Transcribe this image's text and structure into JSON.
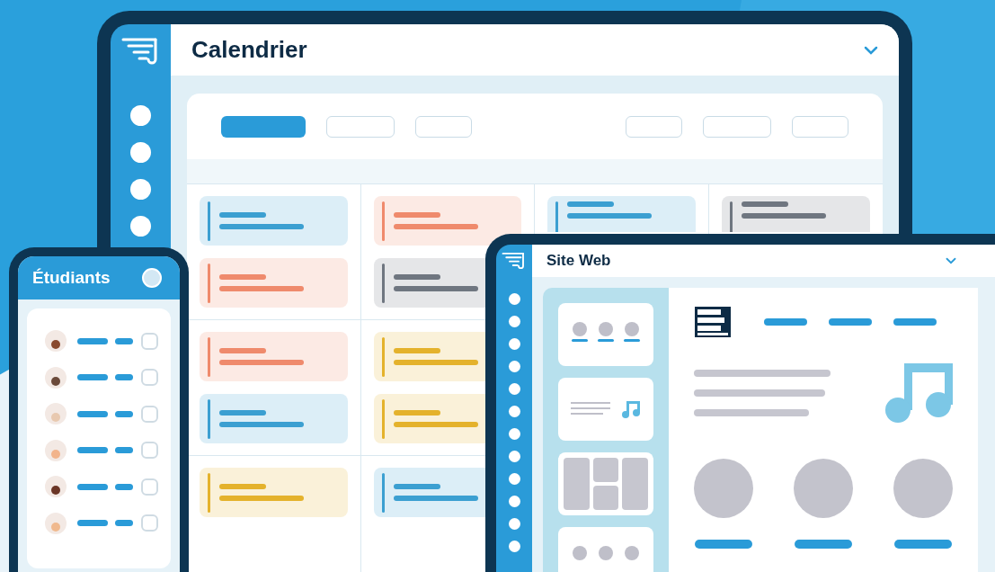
{
  "calendar": {
    "title": "Calendrier",
    "toolbar_buttons": [
      {
        "selected": true
      },
      {
        "selected": false
      },
      {
        "selected": false
      },
      {
        "selected": false
      },
      {
        "selected": false
      },
      {
        "selected": false
      }
    ],
    "weeks": [
      {
        "days": [
          {
            "events": [
              {
                "color": "#3b9fd1"
              },
              {
                "color": "#ef8a6c"
              }
            ]
          },
          {
            "events": [
              {
                "color": "#ef8a6c"
              },
              {
                "color": "#6f7680"
              }
            ]
          },
          {
            "events": [
              {
                "color": "#3b9fd1"
              }
            ]
          },
          {
            "events": [
              {
                "color": "#6f7680"
              }
            ]
          }
        ]
      },
      {
        "days": [
          {
            "events": [
              {
                "color": "#ef8a6c"
              },
              {
                "color": "#3b9fd1"
              }
            ]
          },
          {
            "events": [
              {
                "color": "#e4b22c"
              },
              {
                "color": "#e4b22c"
              }
            ]
          }
        ]
      },
      {
        "days": [
          {
            "events": [
              {
                "color": "#e4b22c"
              }
            ]
          },
          {
            "events": [
              {
                "color": "#3b9fd1"
              }
            ]
          }
        ]
      }
    ]
  },
  "students": {
    "title": "Étudiants",
    "rows": [
      {
        "checked": false
      },
      {
        "checked": false
      },
      {
        "checked": false
      },
      {
        "checked": false
      },
      {
        "checked": false
      },
      {
        "checked": false
      }
    ]
  },
  "website": {
    "title": "Site Web"
  }
}
